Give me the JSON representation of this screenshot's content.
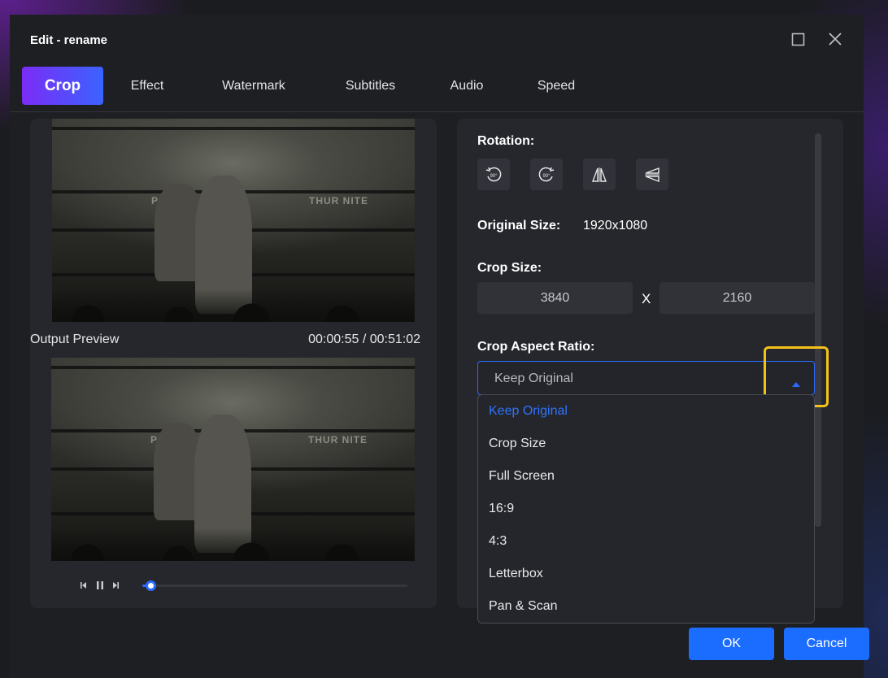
{
  "window": {
    "title": "Edit - rename",
    "maximize_icon": "maximize-icon",
    "close_icon": "close-icon"
  },
  "tabs": [
    {
      "label": "Crop",
      "active": true
    },
    {
      "label": "Effect",
      "active": false
    },
    {
      "label": "Watermark",
      "active": false
    },
    {
      "label": "Subtitles",
      "active": false
    },
    {
      "label": "Audio",
      "active": false
    },
    {
      "label": "Speed",
      "active": false
    }
  ],
  "preview": {
    "label": "Output Preview",
    "time": "00:00:55 / 00:51:02",
    "progress": 0.03,
    "sign_left": "PRO",
    "sign_right": "THUR NITE"
  },
  "settings": {
    "rotation_label": "Rotation:",
    "rotation_buttons": [
      {
        "icon": "rotate-left-90-icon",
        "text": "90°"
      },
      {
        "icon": "rotate-right-90-icon",
        "text": "90°"
      },
      {
        "icon": "flip-horizontal-icon"
      },
      {
        "icon": "flip-vertical-icon"
      }
    ],
    "original_size_label": "Original Size:",
    "original_size_value": "1920x1080",
    "crop_size_label": "Crop Size:",
    "crop_width": "3840",
    "crop_height": "2160",
    "crop_separator": "X",
    "aspect_ratio_label": "Crop Aspect Ratio:",
    "aspect_ratio_value": "Keep Original",
    "aspect_ratio_options": [
      "Keep Original",
      "Crop Size",
      "Full Screen",
      "16:9",
      "4:3",
      "Letterbox",
      "Pan & Scan"
    ]
  },
  "buttons": {
    "ok": "OK",
    "cancel": "Cancel"
  },
  "colors": {
    "accent": "#1b6dff",
    "tab_gradient_start": "#7a2cf6",
    "tab_gradient_end": "#3b63ff",
    "highlight": "#f3c21a"
  }
}
